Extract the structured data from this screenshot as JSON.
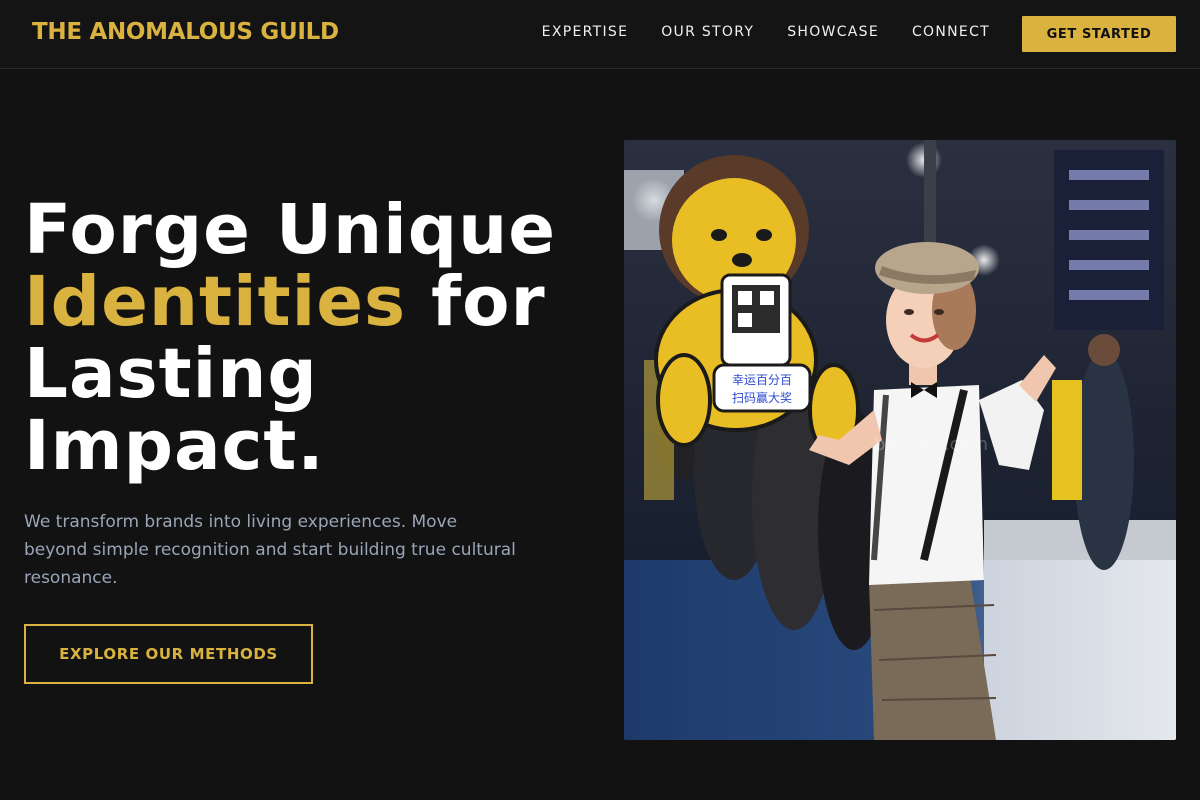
{
  "header": {
    "brand": "THE ANOMALOUS GUILD",
    "nav": [
      "EXPERTISE",
      "OUR STORY",
      "SHOWCASE",
      "CONNECT"
    ],
    "cta_label": "GET STARTED"
  },
  "hero": {
    "headline_part1": "Forge Unique",
    "headline_accent": "Identities",
    "headline_part2": "for Lasting Impact.",
    "subtext": "We transform brands into living experiences. Move beyond simple recognition and start building true cultural resonance.",
    "cta_label": "EXPLORE OUR METHODS",
    "image": {
      "sign_text_line1": "幸运百分百",
      "sign_text_line2": "扫码赢大奖",
      "watermark": "baiyous.com"
    }
  },
  "colors": {
    "background": "#121212",
    "accent": "#d9b23f",
    "subtext": "#9aa6b8"
  }
}
